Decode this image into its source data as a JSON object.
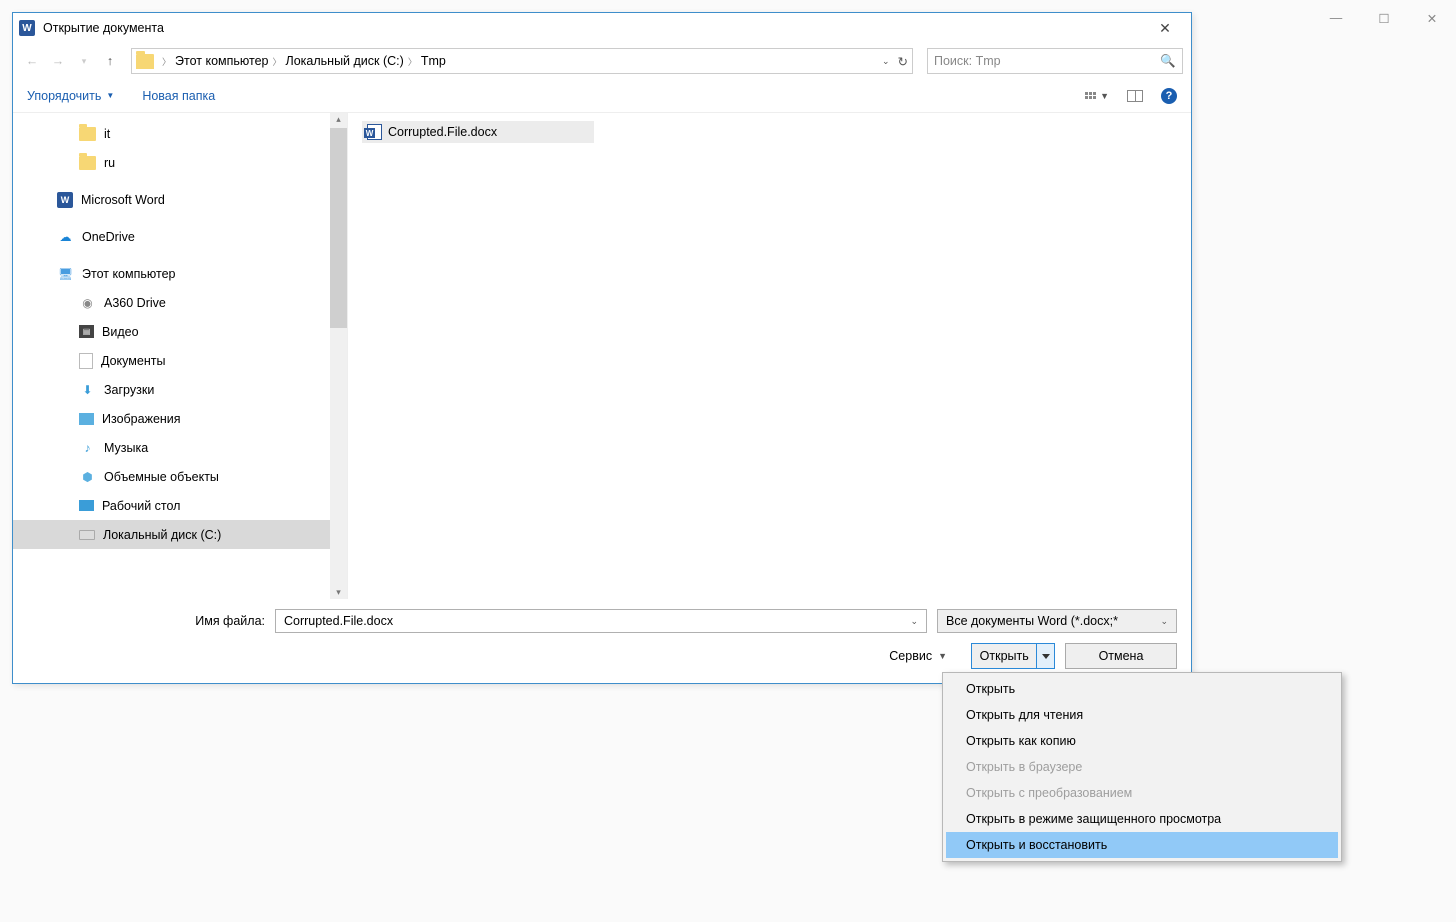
{
  "dialog": {
    "title": "Открытие документа",
    "breadcrumb": {
      "root": "Этот компьютер",
      "drive": "Локальный диск (C:)",
      "folder": "Tmp"
    },
    "search_placeholder": "Поиск: Tmp",
    "toolbar": {
      "organize": "Упорядочить",
      "new_folder": "Новая папка"
    }
  },
  "tree": [
    {
      "label": "it",
      "icon": "folder",
      "depth": 1
    },
    {
      "label": "ru",
      "icon": "folder",
      "depth": 1
    },
    {
      "label": "Microsoft Word",
      "icon": "wordapp",
      "depth": 0
    },
    {
      "label": "OneDrive",
      "icon": "onedrive",
      "depth": 0
    },
    {
      "label": "Этот компьютер",
      "icon": "pc",
      "depth": 0
    },
    {
      "label": "A360 Drive",
      "icon": "a360",
      "depth": 1
    },
    {
      "label": "Видео",
      "icon": "video",
      "depth": 1
    },
    {
      "label": "Документы",
      "icon": "docs",
      "depth": 1
    },
    {
      "label": "Загрузки",
      "icon": "downloads",
      "depth": 1
    },
    {
      "label": "Изображения",
      "icon": "images",
      "depth": 1
    },
    {
      "label": "Музыка",
      "icon": "music",
      "depth": 1
    },
    {
      "label": "Объемные объекты",
      "icon": "3d",
      "depth": 1
    },
    {
      "label": "Рабочий стол",
      "icon": "desktop",
      "depth": 1
    },
    {
      "label": "Локальный диск (C:)",
      "icon": "drive",
      "depth": 1,
      "selected": true
    }
  ],
  "files": [
    {
      "name": "Corrupted.File.docx"
    }
  ],
  "footer": {
    "filename_label": "Имя файла:",
    "filename_value": "Corrupted.File.docx",
    "filter": "Все документы Word (*.docx;*",
    "tools": "Сервис",
    "open": "Открыть",
    "cancel": "Отмена"
  },
  "open_menu": [
    {
      "label": "Открыть",
      "enabled": true
    },
    {
      "label": "Открыть для чтения",
      "enabled": true
    },
    {
      "label": "Открыть как копию",
      "enabled": true
    },
    {
      "label": "Открыть в браузере",
      "enabled": false
    },
    {
      "label": "Открыть с преобразованием",
      "enabled": false
    },
    {
      "label": "Открыть в режиме защищенного просмотра",
      "enabled": true
    },
    {
      "label": "Открыть и восстановить",
      "enabled": true,
      "highlight": true
    }
  ]
}
